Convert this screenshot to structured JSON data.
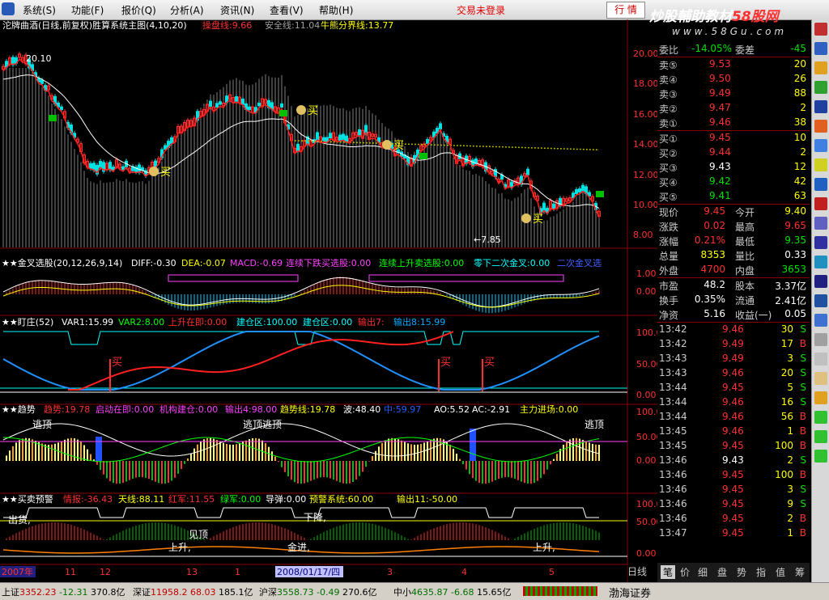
{
  "menu": {
    "items": [
      "系统(S)",
      "功能(F)",
      "报价(Q)",
      "分析(A)",
      "资讯(N)",
      "查看(V)",
      "帮助(H)"
    ],
    "login": "交易未登录",
    "quote_button": "行 情"
  },
  "watermark": {
    "main_white": "炒股輔助教材",
    "main_red": "58股网",
    "sub": "www.58Gu.com"
  },
  "main_chart": {
    "title": "沱牌曲酒(日线,前复权)胜算系统主图(4,10,20)",
    "ind1": "操盘线:9.66",
    "ind2": "安全线:11.04",
    "ind3": "牛熊分界线:13.77",
    "high_label": "20.10",
    "low_label": "←7.85",
    "axis": [
      "20.00",
      "18.00",
      "16.00",
      "14.00",
      "12.00",
      "10.00",
      "8.00"
    ],
    "buy": "买"
  },
  "macd_chart": {
    "title": "★★金叉选股(20,12,26,9,14)",
    "diff": "DIFF:-0.30",
    "dea": "DEA:-0.07",
    "macd": "MACD:-0.69",
    "s1": "连续下跌买选股:0.00",
    "s2": "连续上升卖选股:0.00",
    "s3": "零下二次金叉:0.00",
    "s4": "二次金叉选",
    "axis": [
      "1.00",
      "0.00"
    ]
  },
  "dz_chart": {
    "title": "★★盯庄(52)",
    "var1": "VAR1:15.99",
    "var2": "VAR2:8.00",
    "t1": "上升在即:0.00",
    "t2": "建仓区:100.00",
    "t3": "建仓区:0.00",
    "t4": "输出7:",
    "t5": "输出8:15.99",
    "axis": [
      "100.0",
      "50.00",
      "0.00"
    ],
    "buy": "买"
  },
  "trend_chart": {
    "title": "★★趋势",
    "t1": "趋势:19.78",
    "t2": "启动在即:0.00",
    "t3": "机构建仓:0.00",
    "t4": "输出4:98.00",
    "t5": "趋势线:19.78",
    "t6": "波:48.40",
    "t7": "中:59.97",
    "t8": "AO:5.52",
    "t9": "AC:-2.91",
    "t10": "主力进场:0.00",
    "label1": "逃顶",
    "label2": "逃顶逃顶",
    "label3": "逃顶",
    "axis": [
      "100.0",
      "50.00",
      "0.00"
    ]
  },
  "warn_chart": {
    "title": "★★买卖预警",
    "t1": "情报:-36.43",
    "t2": "天线:88.11",
    "t3": "红军:11.55",
    "t4": "绿军:0.00",
    "t5": "导弹:0.00",
    "t6": "预警系统:60.00",
    "t7": "输出11:-50.00",
    "labels": [
      "出货,",
      "见顶",
      "上升,",
      "下降,",
      "金进,",
      "上升,"
    ],
    "axis": [
      "100.0",
      "50.00",
      "0.00"
    ]
  },
  "time_axis": {
    "start": "2007年",
    "ticks": [
      "11",
      "12",
      "13",
      "1",
      "3",
      "4",
      "5",
      "6"
    ],
    "cursor": "2008/01/17/四"
  },
  "quote": {
    "wb_label": "委比",
    "wb_val": "-14.05%",
    "wc_label": "委差",
    "wc_val": "-45",
    "sells": [
      {
        "label": "卖⑤",
        "price": "9.53",
        "vol": "20"
      },
      {
        "label": "卖④",
        "price": "9.50",
        "vol": "26"
      },
      {
        "label": "卖③",
        "price": "9.49",
        "vol": "88"
      },
      {
        "label": "卖②",
        "price": "9.47",
        "vol": "2"
      },
      {
        "label": "卖①",
        "price": "9.46",
        "vol": "38"
      }
    ],
    "buys": [
      {
        "label": "买①",
        "price": "9.45",
        "vol": "10"
      },
      {
        "label": "买②",
        "price": "9.44",
        "vol": "2"
      },
      {
        "label": "买③",
        "price": "9.43",
        "vol": "12"
      },
      {
        "label": "买④",
        "price": "9.42",
        "vol": "42"
      },
      {
        "label": "买⑤",
        "price": "9.41",
        "vol": "63"
      }
    ],
    "stats": [
      {
        "l1": "现价",
        "v1": "9.45",
        "l2": "今开",
        "v2": "9.40"
      },
      {
        "l1": "涨跌",
        "v1": "0.02",
        "l2": "最高",
        "v2": "9.65"
      },
      {
        "l1": "涨幅",
        "v1": "0.21%",
        "l2": "最低",
        "v2": "9.35"
      },
      {
        "l1": "总量",
        "v1": "8353",
        "l2": "量比",
        "v2": "0.33"
      },
      {
        "l1": "外盘",
        "v1": "4700",
        "l2": "内盘",
        "v2": "3653"
      }
    ],
    "stats2": [
      {
        "l1": "市盈",
        "v1": "48.2",
        "l2": "股本",
        "v2": "3.37亿"
      },
      {
        "l1": "换手",
        "v1": "0.35%",
        "l2": "流通",
        "v2": "2.41亿"
      },
      {
        "l1": "净资",
        "v1": "5.16",
        "l2": "收益(一)",
        "v2": "0.05"
      }
    ],
    "ticks": [
      {
        "t": "13:42",
        "p": "9.46",
        "v": "30",
        "s": "S"
      },
      {
        "t": "13:42",
        "p": "9.49",
        "v": "17",
        "s": "B"
      },
      {
        "t": "13:43",
        "p": "9.49",
        "v": "3",
        "s": "S"
      },
      {
        "t": "13:43",
        "p": "9.46",
        "v": "20",
        "s": "S"
      },
      {
        "t": "13:44",
        "p": "9.45",
        "v": "5",
        "s": "S"
      },
      {
        "t": "13:44",
        "p": "9.46",
        "v": "16",
        "s": "S"
      },
      {
        "t": "13:44",
        "p": "9.46",
        "v": "56",
        "s": "B"
      },
      {
        "t": "13:45",
        "p": "9.46",
        "v": "1",
        "s": "B"
      },
      {
        "t": "13:45",
        "p": "9.45",
        "v": "100",
        "s": "B"
      },
      {
        "t": "13:46",
        "p": "9.43",
        "v": "2",
        "s": "S"
      },
      {
        "t": "13:46",
        "p": "9.45",
        "v": "100",
        "s": "B"
      },
      {
        "t": "13:46",
        "p": "9.45",
        "v": "3",
        "s": "S"
      },
      {
        "t": "13:46",
        "p": "9.45",
        "v": "9",
        "s": "S"
      },
      {
        "t": "13:46",
        "p": "9.45",
        "v": "2",
        "s": "B"
      },
      {
        "t": "13:47",
        "p": "9.45",
        "v": "1",
        "s": "B"
      }
    ]
  },
  "tabs": [
    "笔",
    "价",
    "细",
    "盘",
    "势",
    "指",
    "值",
    "筹"
  ],
  "day_tab": "日线",
  "status": {
    "sh_label": "上证",
    "sh_val": "3352.23",
    "sh_chg": "-12.31",
    "sh_amt": "370.8亿",
    "sz_label": "深证",
    "sz_val": "11958.2",
    "sz_chg": "68.03",
    "sz_amt": "185.1亿",
    "hs_label": "沪深",
    "hs_val": "3558.73",
    "hs_chg": "-0.49",
    "hs_amt": "270.6亿",
    "zx_label": "中小",
    "zx_val": "4635.87",
    "zx_chg": "-6.68",
    "zx_amt": "15.65亿",
    "broker": "渤海证券"
  },
  "colors": {
    "up": "#ff3030",
    "down": "#00e000",
    "yellow": "#ffff00",
    "white": "#ffffff",
    "cyan": "#00ffff"
  }
}
